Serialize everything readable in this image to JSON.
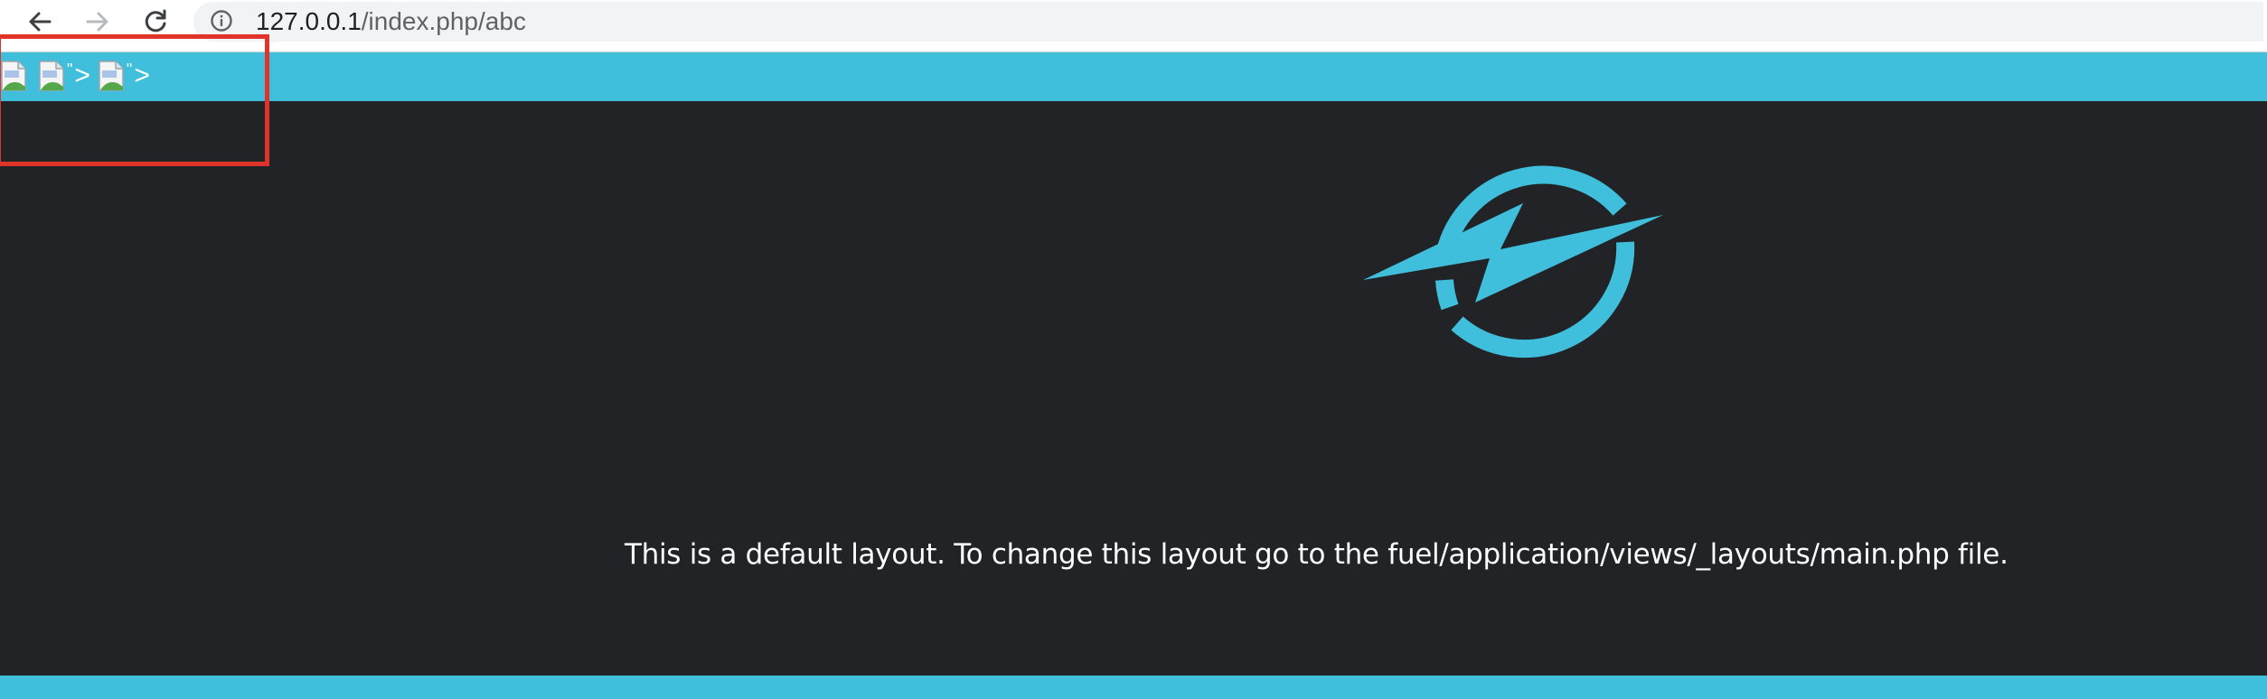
{
  "browser": {
    "url_host": "127.0.0.1",
    "url_path": "/index.php/abc",
    "icons": {
      "back": "arrow-left-icon",
      "forward": "arrow-right-icon",
      "reload": "reload-icon",
      "info": "info-icon"
    }
  },
  "header": {
    "crumbs": [
      {
        "icon": "broken-image-icon",
        "quote": "",
        "separator": ""
      },
      {
        "icon": "broken-image-icon",
        "quote": "\"",
        "separator": ">"
      },
      {
        "icon": "broken-image-icon",
        "quote": "\"",
        "separator": ">"
      }
    ]
  },
  "main": {
    "message": "This is a default layout. To change this layout go to the fuel/application/views/_layouts/main.php file."
  },
  "colors": {
    "accent": "#3fbfdb",
    "background": "#222327",
    "highlight": "#e0342b"
  }
}
